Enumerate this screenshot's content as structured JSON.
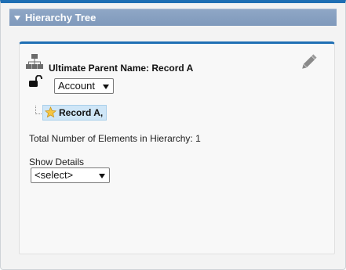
{
  "section": {
    "title": "Hierarchy Tree",
    "toggle_icon": "triangle-down-icon"
  },
  "card": {
    "parent_label": "Ultimate Parent Name:",
    "parent_value": "Record A",
    "icons": {
      "hierarchy": "hierarchy-icon",
      "lock": "unlocked-lock-icon",
      "edit": "pencil-icon"
    },
    "object_select": {
      "value": "Account"
    },
    "tree": [
      {
        "label": "Record A,",
        "icon": "star-icon"
      }
    ],
    "total_label": "Total Number of Elements in Hierarchy: 1",
    "details": {
      "label": "Show Details",
      "value": "<select>"
    }
  },
  "colors": {
    "accent": "#1f6fb4",
    "header_bg": "#879fc1",
    "node_highlight": "#cfe6f7",
    "star": "#f5c542"
  }
}
